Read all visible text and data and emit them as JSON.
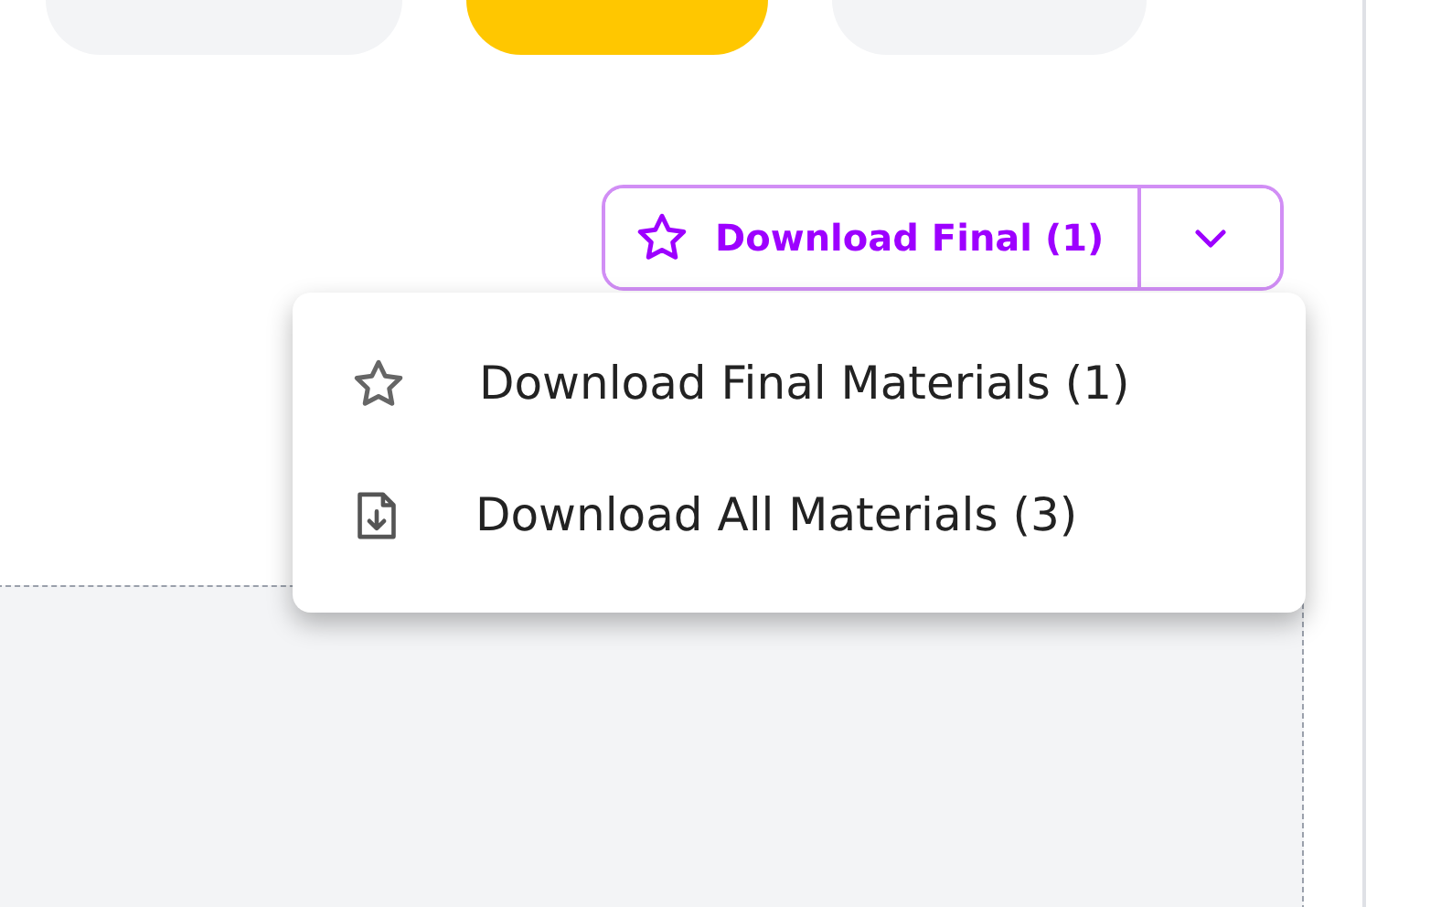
{
  "filter_tabs": [
    {
      "selected": false
    },
    {
      "selected": true
    },
    {
      "selected": false
    }
  ],
  "download_button": {
    "label": "Download Final (1)"
  },
  "download_menu": {
    "expanded": true,
    "items": [
      {
        "kind": "star",
        "label": "Download Final Materials (1)"
      },
      {
        "kind": "file",
        "label": "Download All Materials (3)"
      }
    ]
  }
}
